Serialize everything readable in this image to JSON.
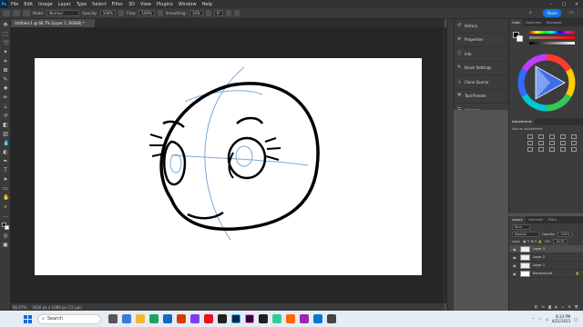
{
  "menu": {
    "logo": "Ps",
    "items": [
      "File",
      "Edit",
      "Image",
      "Layer",
      "Type",
      "Select",
      "Filter",
      "3D",
      "View",
      "Plugins",
      "Window",
      "Help"
    ]
  },
  "options": {
    "mode_label": "Mode:",
    "mode_value": "Normal",
    "opacity_label": "Opacity:",
    "opacity_value": "100%",
    "flow_label": "Flow:",
    "flow_value": "100%",
    "smoothing_label": "Smoothing:",
    "smoothing_value": "10%",
    "angle_value": "0°",
    "share_label": "Share"
  },
  "document": {
    "tab_title": "Untitled-1 @ 66.7% (Layer 1, RGB/8) *"
  },
  "status": {
    "zoom": "66.67%",
    "doc_size": "1920 px x 1080 px (72 ppi)"
  },
  "side_panels": [
    {
      "label": "History",
      "icon": "history-icon"
    },
    {
      "label": "Properties",
      "icon": "properties-icon"
    },
    {
      "label": "Info",
      "icon": "info-icon"
    },
    {
      "label": "Brush Settings",
      "icon": "brush-settings-icon"
    },
    {
      "label": "Clone Source",
      "icon": "clone-source-icon"
    },
    {
      "label": "Tool Presets",
      "icon": "tool-presets-icon"
    },
    {
      "label": "Libraries",
      "icon": "libraries-icon"
    }
  ],
  "color_panel": {
    "tabs": [
      "Color",
      "Swatches",
      "Navigator"
    ],
    "active_tab": "Color",
    "foreground": "#000000",
    "background": "#ffffff"
  },
  "adjustments": {
    "title": "Adjustments",
    "subtitle": "Add an adjustment"
  },
  "layers": {
    "tabs": [
      "Layers",
      "Channels",
      "Paths"
    ],
    "kind_label": "Kind",
    "blend_mode": "Normal",
    "opacity_label": "Opacity:",
    "opacity_value": "100%",
    "lock_label": "Lock:",
    "fill_label": "Fill:",
    "fill_value": "100%",
    "items": [
      {
        "name": "Layer 3"
      },
      {
        "name": "Layer 2"
      },
      {
        "name": "Layer 1"
      },
      {
        "name": "Background"
      }
    ]
  },
  "taskbar": {
    "search_placeholder": "Search",
    "time": "8:33 PM",
    "date": "4/21/2023"
  },
  "colors": {
    "accent": "#1473e6",
    "guide_blue": "#7aa9d6",
    "ink": "#000000"
  }
}
